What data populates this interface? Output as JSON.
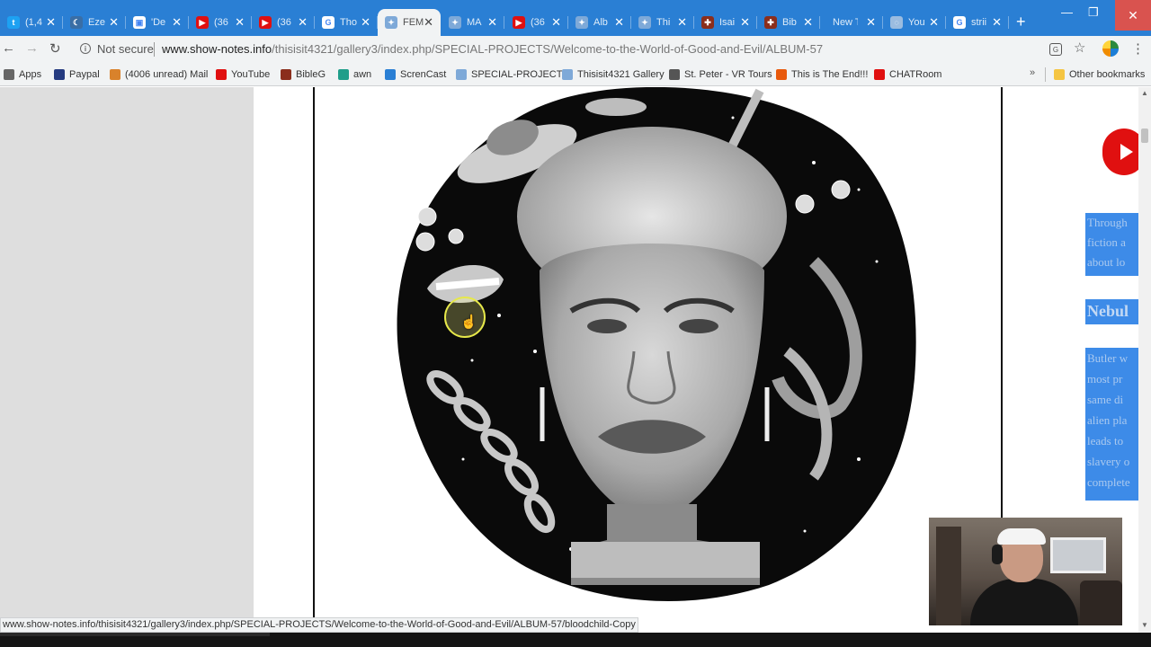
{
  "browser": {
    "tabs": [
      {
        "title": "(1,4",
        "favicon": "twitter-bird-icon",
        "color": "#1da1f2",
        "glyph": "t",
        "active": false
      },
      {
        "title": "Eze",
        "favicon": "moon-icon",
        "color": "#3a6ea5",
        "glyph": "☾",
        "active": false
      },
      {
        "title": "'De",
        "favicon": "document-icon",
        "color": "#ffffff",
        "glyph": "▣",
        "active": false
      },
      {
        "title": "(36",
        "favicon": "youtube-icon",
        "color": "#e01010",
        "glyph": "▶",
        "active": false
      },
      {
        "title": "(36",
        "favicon": "youtube-icon",
        "color": "#e01010",
        "glyph": "▶",
        "active": false
      },
      {
        "title": "Tho",
        "favicon": "google-icon",
        "color": "#ffffff",
        "glyph": "G",
        "active": false
      },
      {
        "title": "FEM",
        "favicon": "gallery-icon",
        "color": "#7ea9d8",
        "glyph": "✦",
        "active": true
      },
      {
        "title": "MA",
        "favicon": "gallery-icon",
        "color": "#7ea9d8",
        "glyph": "✦",
        "active": false
      },
      {
        "title": "(36",
        "favicon": "youtube-icon",
        "color": "#e01010",
        "glyph": "▶",
        "active": false
      },
      {
        "title": "Alb",
        "favicon": "gallery-icon",
        "color": "#7ea9d8",
        "glyph": "✦",
        "active": false
      },
      {
        "title": "Thi",
        "favicon": "gallery-icon",
        "color": "#7ea9d8",
        "glyph": "✦",
        "active": false
      },
      {
        "title": "Isai",
        "favicon": "bible-icon",
        "color": "#8b2e1c",
        "glyph": "✚",
        "active": false
      },
      {
        "title": "Bib",
        "favicon": "bible-icon",
        "color": "#8b2e1c",
        "glyph": "✚",
        "active": false
      },
      {
        "title": "New Ta",
        "favicon": "",
        "color": "",
        "glyph": "",
        "active": false
      },
      {
        "title": "You",
        "favicon": "loading-icon",
        "color": "#9bbce0",
        "glyph": "◌",
        "active": false
      },
      {
        "title": "strii",
        "favicon": "google-icon",
        "color": "#ffffff",
        "glyph": "G",
        "active": false
      }
    ],
    "new_tab_label": "+",
    "window_controls": {
      "minimize": "—",
      "maximize": "❐",
      "close": "✕"
    },
    "toolbar": {
      "back": "←",
      "forward": "→",
      "reload": "↻",
      "security_text": "Not secure",
      "url_host": "www.show-notes.info",
      "url_path": "/thisisit4321/gallery3/index.php/SPECIAL-PROJECTS/Welcome-to-the-World-of-Good-and-Evil/ALBUM-57",
      "star": "☆",
      "menu": "⋮"
    },
    "bookmarks": [
      {
        "label": "Apps",
        "icon": "apps-grid-icon",
        "color": "#666666"
      },
      {
        "label": "Paypal",
        "icon": "paypal-icon",
        "color": "#253b80"
      },
      {
        "label": "(4006 unread) Mail",
        "icon": "mail-icon",
        "color": "#d9822b"
      },
      {
        "label": "YouTube",
        "icon": "youtube-icon",
        "color": "#e01010"
      },
      {
        "label": "BibleG",
        "icon": "bible-icon",
        "color": "#8b2e1c"
      },
      {
        "label": "awn",
        "icon": "awn-icon",
        "color": "#1f9e8a"
      },
      {
        "label": "ScrenCast",
        "icon": "screencast-icon",
        "color": "#2a7fd4"
      },
      {
        "label": "SPECIAL-PROJECTS",
        "icon": "gallery-icon",
        "color": "#7ea9d8"
      },
      {
        "label": "Thisisit4321 Gallery",
        "icon": "gallery-icon",
        "color": "#7ea9d8"
      },
      {
        "label": "St. Peter - VR Tours",
        "icon": "vr-icon",
        "color": "#555555"
      },
      {
        "label": "This is The End!!!",
        "icon": "camera-icon",
        "color": "#e8590c"
      },
      {
        "label": "CHATRoom",
        "icon": "youtube-icon",
        "color": "#e01010"
      }
    ],
    "bookmarks_more": "»",
    "other_bookmarks": "Other bookmarks",
    "status_url": "www.show-notes.info/thisisit4321/gallery3/index.php/SPECIAL-PROJECTS/Welcome-to-the-World-of-Good-and-Evil/ALBUM-57/bloodchild-Copy"
  },
  "page": {
    "side_text": [
      "Through",
      "fiction a",
      "about lo",
      "Nebul",
      "Butler w",
      "most pr",
      "same di",
      "alien pla",
      "leads to",
      "slavery o",
      "complete"
    ],
    "colors": {
      "accent_blue": "#3d8be8",
      "youtube_red": "#e01010",
      "tab_blue": "#2a7fd4"
    }
  }
}
